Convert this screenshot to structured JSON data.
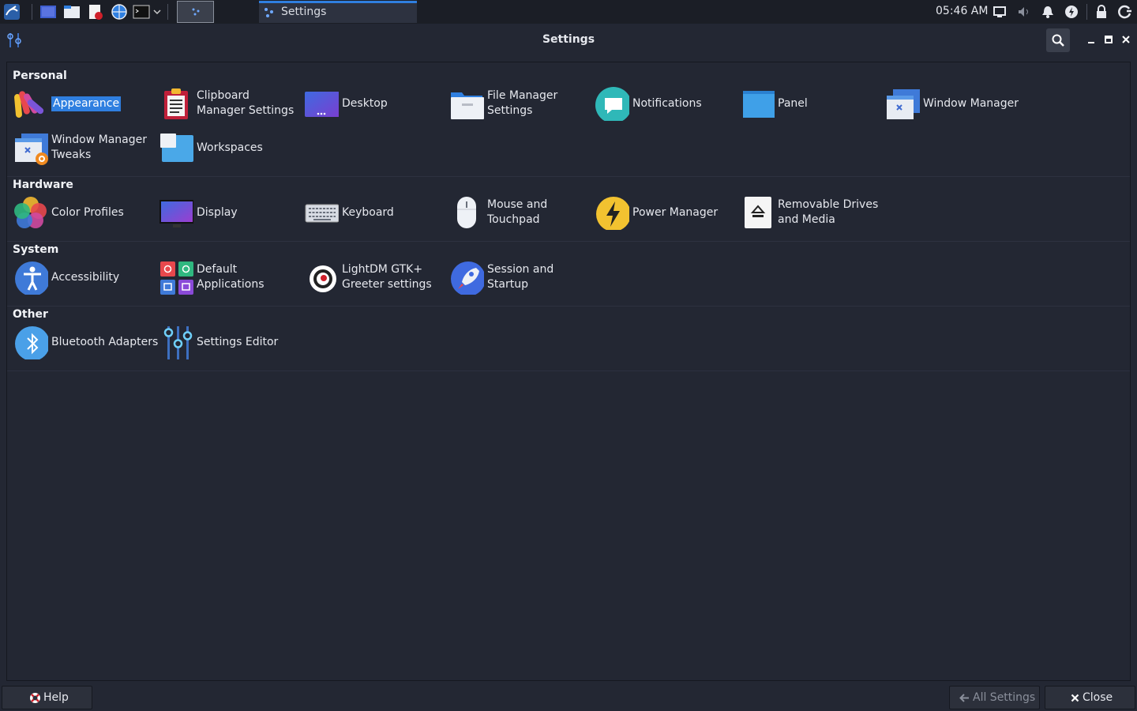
{
  "taskbar": {
    "task_title": "Settings",
    "clock": "05:46 AM"
  },
  "window": {
    "title": "Settings"
  },
  "sections": {
    "personal": {
      "title": "Personal",
      "items": [
        {
          "label": "Appearance"
        },
        {
          "label": "Clipboard\nManager Settings"
        },
        {
          "label": "Desktop"
        },
        {
          "label": "File Manager\nSettings"
        },
        {
          "label": "Notifications"
        },
        {
          "label": "Panel"
        },
        {
          "label": "Window Manager"
        },
        {
          "label": "Window Manager\nTweaks"
        },
        {
          "label": "Workspaces"
        }
      ]
    },
    "hardware": {
      "title": "Hardware",
      "items": [
        {
          "label": "Color Profiles"
        },
        {
          "label": "Display"
        },
        {
          "label": "Keyboard"
        },
        {
          "label": "Mouse and\nTouchpad"
        },
        {
          "label": "Power Manager"
        },
        {
          "label": "Removable Drives\nand Media"
        }
      ]
    },
    "system": {
      "title": "System",
      "items": [
        {
          "label": "Accessibility"
        },
        {
          "label": "Default\nApplications"
        },
        {
          "label": "LightDM GTK+\nGreeter settings"
        },
        {
          "label": "Session and\nStartup"
        }
      ]
    },
    "other": {
      "title": "Other",
      "items": [
        {
          "label": "Bluetooth Adapters"
        },
        {
          "label": "Settings Editor"
        }
      ]
    }
  },
  "buttons": {
    "help": "Help",
    "all_settings": "All Settings",
    "close": "Close"
  },
  "colors": {
    "accent": "#2f7fe0",
    "background": "#232733",
    "taskbar": "#1b1e26"
  }
}
